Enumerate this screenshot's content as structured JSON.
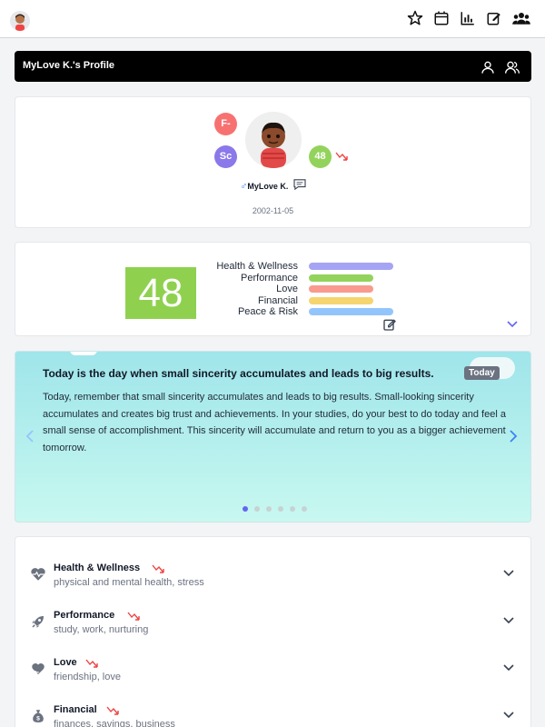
{
  "topbar": {
    "icons": [
      "user-avatar",
      "star-icon",
      "calendar-icon",
      "chart-icon",
      "edit-icon",
      "group-icon"
    ]
  },
  "header": {
    "title": "MyLove K.'s Profile",
    "icons": [
      "user-icon",
      "users-icon"
    ]
  },
  "profile": {
    "grade": "F-",
    "sc": "Sc",
    "score": "48",
    "name": "MyLove K.",
    "gender_symbol": "♂",
    "dob": "2002-11-05",
    "trend": "down"
  },
  "score_panel": {
    "score": "48",
    "categories": [
      {
        "label": "Health & Wellness",
        "color": "#a5a4f4",
        "value": 0.95
      },
      {
        "label": "Performance",
        "color": "#93d35c",
        "value": 0.72
      },
      {
        "label": "Love",
        "color": "#f99a8e",
        "value": 0.72
      },
      {
        "label": "Financial",
        "color": "#f6d56f",
        "value": 0.72
      },
      {
        "label": "Peace & Risk",
        "color": "#93c5fd",
        "value": 0.95
      }
    ]
  },
  "message": {
    "title": "Today is the day when small sincerity accumulates and leads to big results.",
    "badge": "Today",
    "body": "Today, remember that small sincerity accumulates and leads to big results. Small-looking sincerity accumulates and creates big trust and achievements. In your studies, do your best to do today and feel a small sense of accomplishment. This sincerity will accumulate and return to you as a bigger achievement tomorrow.",
    "page": 1,
    "pages": 6
  },
  "categories": [
    {
      "title": "Health & Wellness",
      "subtitle": "physical and mental health, stress",
      "icon": "heartbeat-icon",
      "trend": "down"
    },
    {
      "title": "Performance",
      "subtitle": "study, work, nurturing",
      "icon": "rocket-icon",
      "trend": "down"
    },
    {
      "title": "Love",
      "subtitle": "friendship, love",
      "icon": "heart-hand-icon",
      "trend": "down"
    },
    {
      "title": "Financial",
      "subtitle": "finances, savings, business",
      "icon": "money-bag-icon",
      "trend": "down"
    }
  ],
  "colors": {
    "trend_down": "#ef4444",
    "score_green": "#8fd14f",
    "accent": "#6366f1"
  }
}
